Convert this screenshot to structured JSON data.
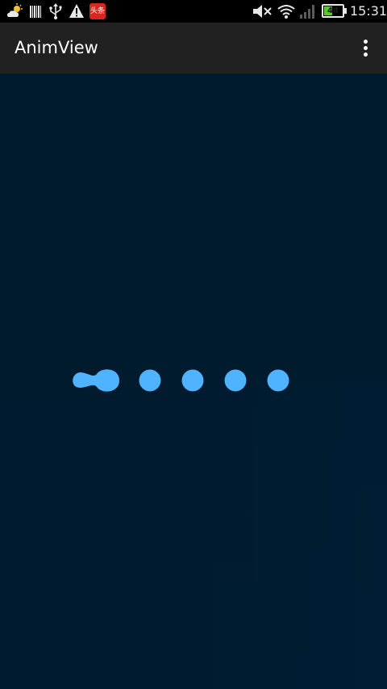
{
  "status_bar": {
    "icons": [
      "weather-icon",
      "barcode-icon",
      "usb-icon",
      "warning-icon",
      "news-app-icon",
      "mute-icon",
      "wifi-icon",
      "signal-icon",
      "battery-icon"
    ],
    "news_badge_text": "头条",
    "battery_level": "44",
    "battery_fraction": 0.44,
    "time": "15:31"
  },
  "action_bar": {
    "title": "AnimView",
    "overflow_icon": "more-vert-icon"
  },
  "anim_view": {
    "dot_count": 5,
    "merged_dots": 2,
    "dot_color": "#4fb3ff",
    "background_color": "#001a2e"
  },
  "colors": {
    "status_bar_bg": "#000000",
    "action_bar_bg": "#212121",
    "content_bg": "#001a2e",
    "accent": "#4fb3ff",
    "battery_green": "#5ec633"
  }
}
